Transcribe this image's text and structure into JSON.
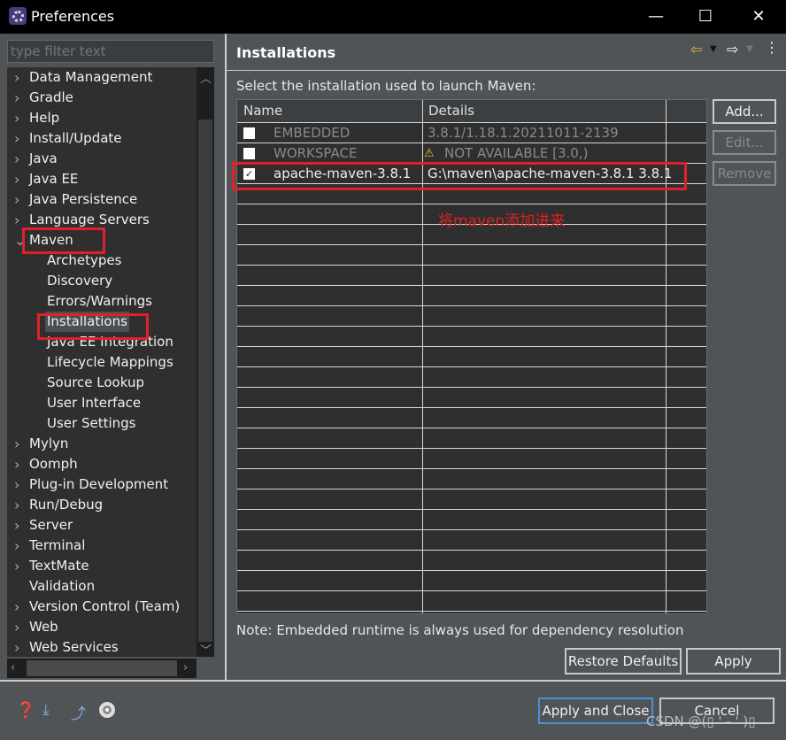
{
  "window": {
    "title": "Preferences",
    "minimize": "—",
    "maximize": "☐",
    "close": "✕"
  },
  "filter": {
    "placeholder": "type filter text"
  },
  "tree": [
    {
      "label": "Data Management",
      "level": 0,
      "expandable": true
    },
    {
      "label": "Gradle",
      "level": 0,
      "expandable": true
    },
    {
      "label": "Help",
      "level": 0,
      "expandable": true
    },
    {
      "label": "Install/Update",
      "level": 0,
      "expandable": true
    },
    {
      "label": "Java",
      "level": 0,
      "expandable": true
    },
    {
      "label": "Java EE",
      "level": 0,
      "expandable": true
    },
    {
      "label": "Java Persistence",
      "level": 0,
      "expandable": true
    },
    {
      "label": "Language Servers",
      "level": 0,
      "expandable": true
    },
    {
      "label": "Maven",
      "level": 0,
      "expandable": true,
      "expanded": true
    },
    {
      "label": "Archetypes",
      "level": 1
    },
    {
      "label": "Discovery",
      "level": 1
    },
    {
      "label": "Errors/Warnings",
      "level": 1
    },
    {
      "label": "Installations",
      "level": 1,
      "selected": true
    },
    {
      "label": "Java EE Integration",
      "level": 1
    },
    {
      "label": "Lifecycle Mappings",
      "level": 1
    },
    {
      "label": "Source Lookup",
      "level": 1
    },
    {
      "label": "User Interface",
      "level": 1
    },
    {
      "label": "User Settings",
      "level": 1
    },
    {
      "label": "Mylyn",
      "level": 0,
      "expandable": true
    },
    {
      "label": "Oomph",
      "level": 0,
      "expandable": true
    },
    {
      "label": "Plug-in Development",
      "level": 0,
      "expandable": true
    },
    {
      "label": "Run/Debug",
      "level": 0,
      "expandable": true
    },
    {
      "label": "Server",
      "level": 0,
      "expandable": true
    },
    {
      "label": "Terminal",
      "level": 0,
      "expandable": true
    },
    {
      "label": "TextMate",
      "level": 0,
      "expandable": true
    },
    {
      "label": "Validation",
      "level": 0,
      "expandable": false
    },
    {
      "label": "Version Control (Team)",
      "level": 0,
      "expandable": true
    },
    {
      "label": "Web",
      "level": 0,
      "expandable": true
    },
    {
      "label": "Web Services",
      "level": 0,
      "expandable": true
    }
  ],
  "page": {
    "title": "Installations",
    "description": "Select the installation used to launch Maven:",
    "columns": [
      "Name",
      "Details"
    ],
    "rows": [
      {
        "checked": false,
        "name": "EMBEDDED",
        "details": "3.8.1/1.18.1.20211011-2139",
        "enabled": false,
        "warning": false
      },
      {
        "checked": false,
        "name": "WORKSPACE",
        "details": "NOT AVAILABLE [3.0,)",
        "enabled": false,
        "warning": true
      },
      {
        "checked": true,
        "name": "apache-maven-3.8.1",
        "details": "G:\\maven\\apache-maven-3.8.1 3.8.1",
        "enabled": true,
        "warning": false
      }
    ],
    "buttons": {
      "add": "Add...",
      "edit": "Edit...",
      "remove": "Remove"
    },
    "annotation": "将maven添加进来",
    "note": "Note: Embedded runtime is always used for dependency resolution",
    "restore_defaults": "Restore Defaults",
    "apply": "Apply"
  },
  "footer": {
    "apply_close": "Apply and Close",
    "cancel": "Cancel"
  },
  "watermark": "CSDN @(▯ ' - ' )▯",
  "colors": {
    "accent_red": "#e0202a",
    "warning": "#f0c020"
  }
}
